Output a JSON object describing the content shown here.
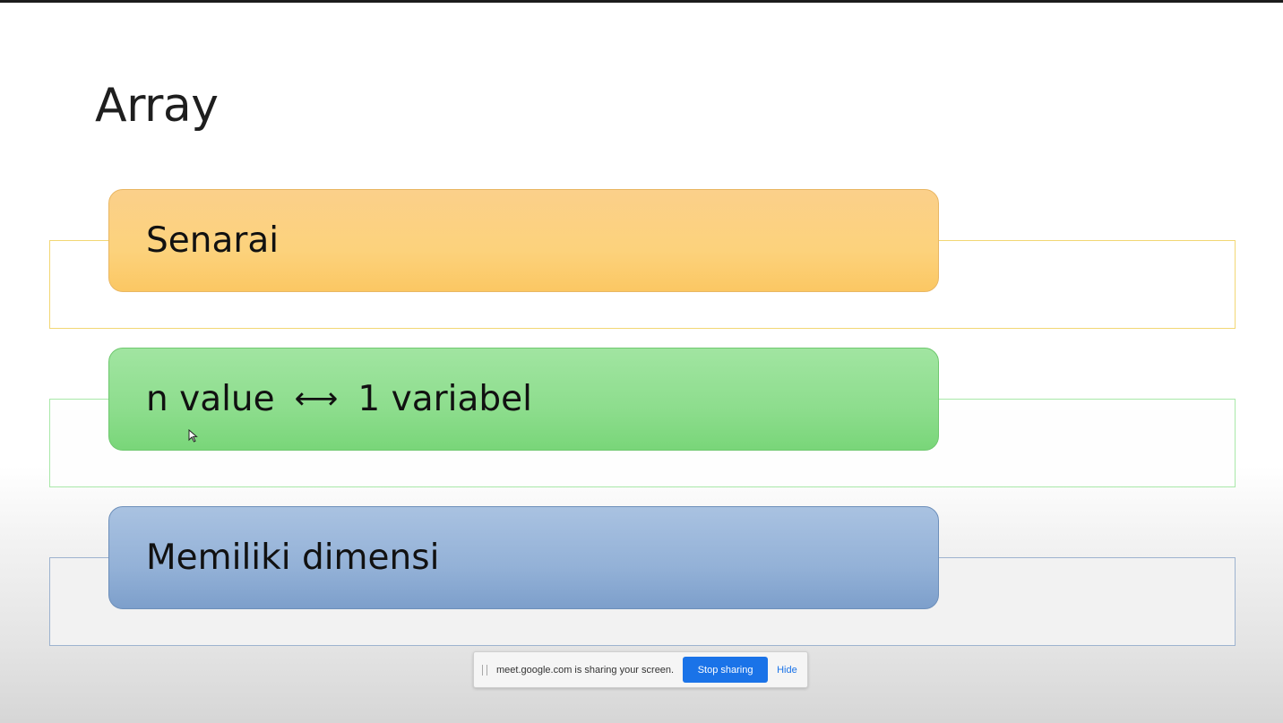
{
  "slide": {
    "title": "Array",
    "items": [
      {
        "label": "Senarai",
        "color": "#fcd27c"
      },
      {
        "label_left": "n value",
        "arrow": "⟷",
        "label_right": "1 variabel",
        "color": "#8ddd8d"
      },
      {
        "label": "Memiliki dimensi",
        "color": "#93b1d7"
      }
    ]
  },
  "share_bar": {
    "message": "meet.google.com is sharing your screen.",
    "stop_label": "Stop sharing",
    "hide_label": "Hide",
    "accent": "#1a73e8"
  }
}
